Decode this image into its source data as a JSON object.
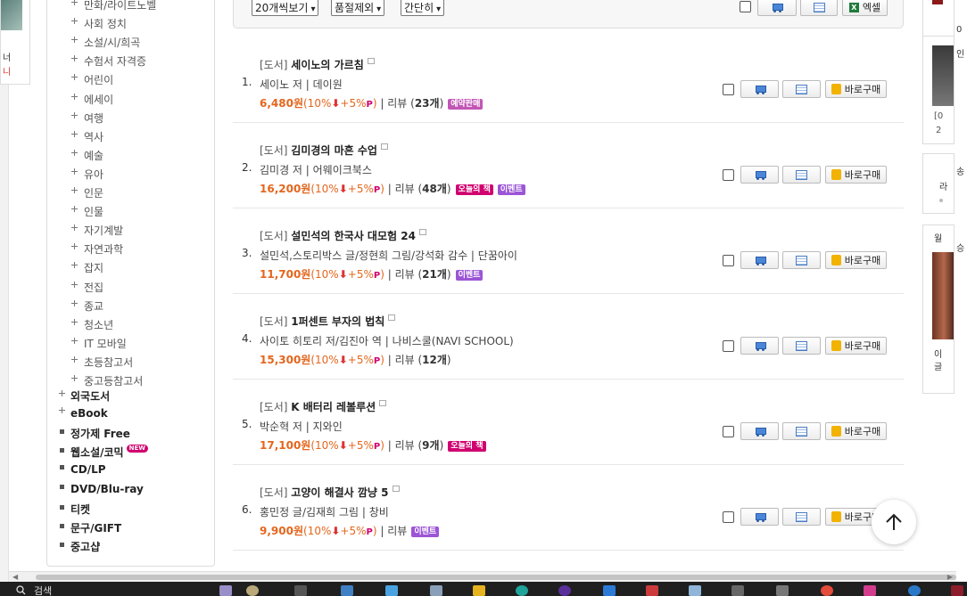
{
  "promo": {
    "line1": "너",
    "line2": "니"
  },
  "categories": {
    "sub": [
      "만화/라이트노벨",
      "사회 정치",
      "소설/시/희곡",
      "수험서 자격증",
      "어린이",
      "에세이",
      "여행",
      "역사",
      "예술",
      "유아",
      "인문",
      "인물",
      "자기계발",
      "자연과학",
      "잡지",
      "전집",
      "종교",
      "청소년",
      "IT 모바일",
      "초등참고서",
      "중고등참고서"
    ],
    "top": [
      "외국도서",
      "eBook",
      "정가제 Free",
      "웹소설/코믹",
      "CD/LP",
      "DVD/Blu-ray",
      "티켓",
      "문구/GIFT",
      "중고샵"
    ],
    "new_badge": "NEW"
  },
  "toolbar": {
    "per_page": "20개씩보기",
    "soldout": "품절제외",
    "view": "간단히",
    "excel": "엑셀"
  },
  "buy_label": "바로구매",
  "books": [
    {
      "num": "1.",
      "cat": "[도서]",
      "title": "세이노의 가르침",
      "author": "세이노 저 | 데이원",
      "price": "6,480원",
      "disc": "(10%",
      "pt": "+5%",
      "reviews": "23개",
      "badges": [
        {
          "t": "예약판매",
          "k": "pre"
        }
      ]
    },
    {
      "num": "2.",
      "cat": "[도서]",
      "title": "김미경의 마흔 수업",
      "author": "김미경 저 | 어웨이크북스",
      "price": "16,200원",
      "disc": "(10%",
      "pt": "+5%",
      "reviews": "48개",
      "badges": [
        {
          "t": "오늘의 책",
          "k": "today"
        },
        {
          "t": "이벤트",
          "k": "event"
        }
      ]
    },
    {
      "num": "3.",
      "cat": "[도서]",
      "title": "설민석의 한국사 대모험 24",
      "author": "설민석,스토리박스 글/정현희 그림/강석화 감수 | 단꿈아이",
      "price": "11,700원",
      "disc": "(10%",
      "pt": "+5%",
      "reviews": "21개",
      "badges": [
        {
          "t": "이벤트",
          "k": "event"
        }
      ]
    },
    {
      "num": "4.",
      "cat": "[도서]",
      "title": "1퍼센트 부자의 법칙",
      "author": "사이토 히토리 저/김진아 역 | 나비스쿨(NAVI SCHOOL)",
      "price": "15,300원",
      "disc": "(10%",
      "pt": "+5%",
      "reviews": "12개",
      "badges": []
    },
    {
      "num": "5.",
      "cat": "[도서]",
      "title": "K 배터리 레볼루션",
      "author": "박순혁 저 | 지와인",
      "price": "17,100원",
      "disc": "(10%",
      "pt": "+5%",
      "reviews": "9개",
      "badges": [
        {
          "t": "오늘의 책",
          "k": "today"
        }
      ]
    },
    {
      "num": "6.",
      "cat": "[도서]",
      "title": "고양이 해결사 깜냥 5",
      "author": "홍민정 글/김재희 그림 | 창비",
      "price": "9,900원",
      "disc": "(10%",
      "pt": "+5%",
      "reviews": "",
      "badges": [
        {
          "t": "이벤트",
          "k": "event"
        }
      ]
    }
  ],
  "review_label": "리뷰",
  "taskbar": {
    "search": "검색"
  },
  "right_texts": [
    "인",
    "[0",
    "2",
    "송",
    "승",
    "월",
    "이",
    "글"
  ]
}
